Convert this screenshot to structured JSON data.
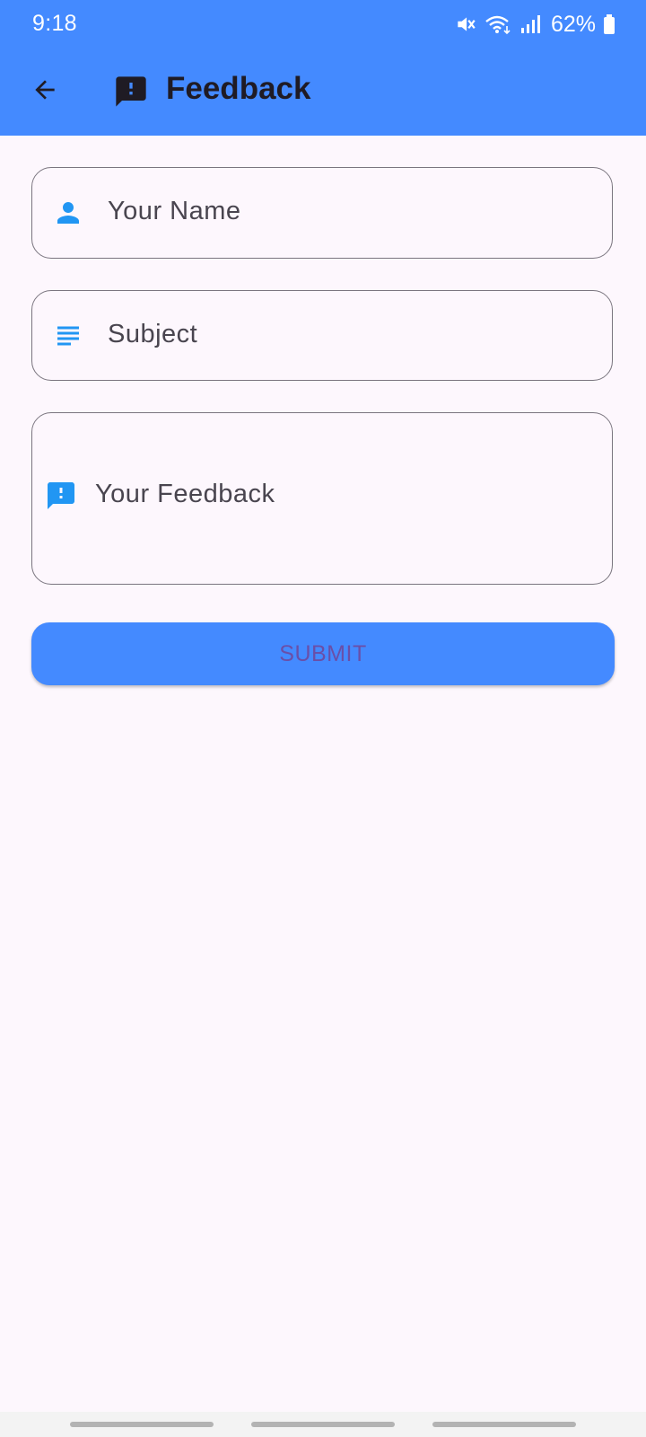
{
  "status_bar": {
    "time": "9:18",
    "battery": "62%",
    "icons": [
      "mute-icon",
      "wifi-icon",
      "signal-icon",
      "battery-icon"
    ]
  },
  "app_bar": {
    "title": "Feedback",
    "back_icon": "arrow-back-icon",
    "title_icon": "feedback-icon",
    "color": "#448aff"
  },
  "form": {
    "name_field": {
      "placeholder": "Your Name",
      "value": "",
      "icon": "person-icon"
    },
    "subject_field": {
      "placeholder": "Subject",
      "value": "",
      "icon": "subject-icon"
    },
    "feedback_field": {
      "placeholder": "Your Feedback",
      "value": "",
      "icon": "feedback-icon"
    },
    "icon_color": "#2196f3"
  },
  "submit": {
    "label": "SUBMIT",
    "background": "#448aff",
    "text_color": "#6a4fa8"
  }
}
